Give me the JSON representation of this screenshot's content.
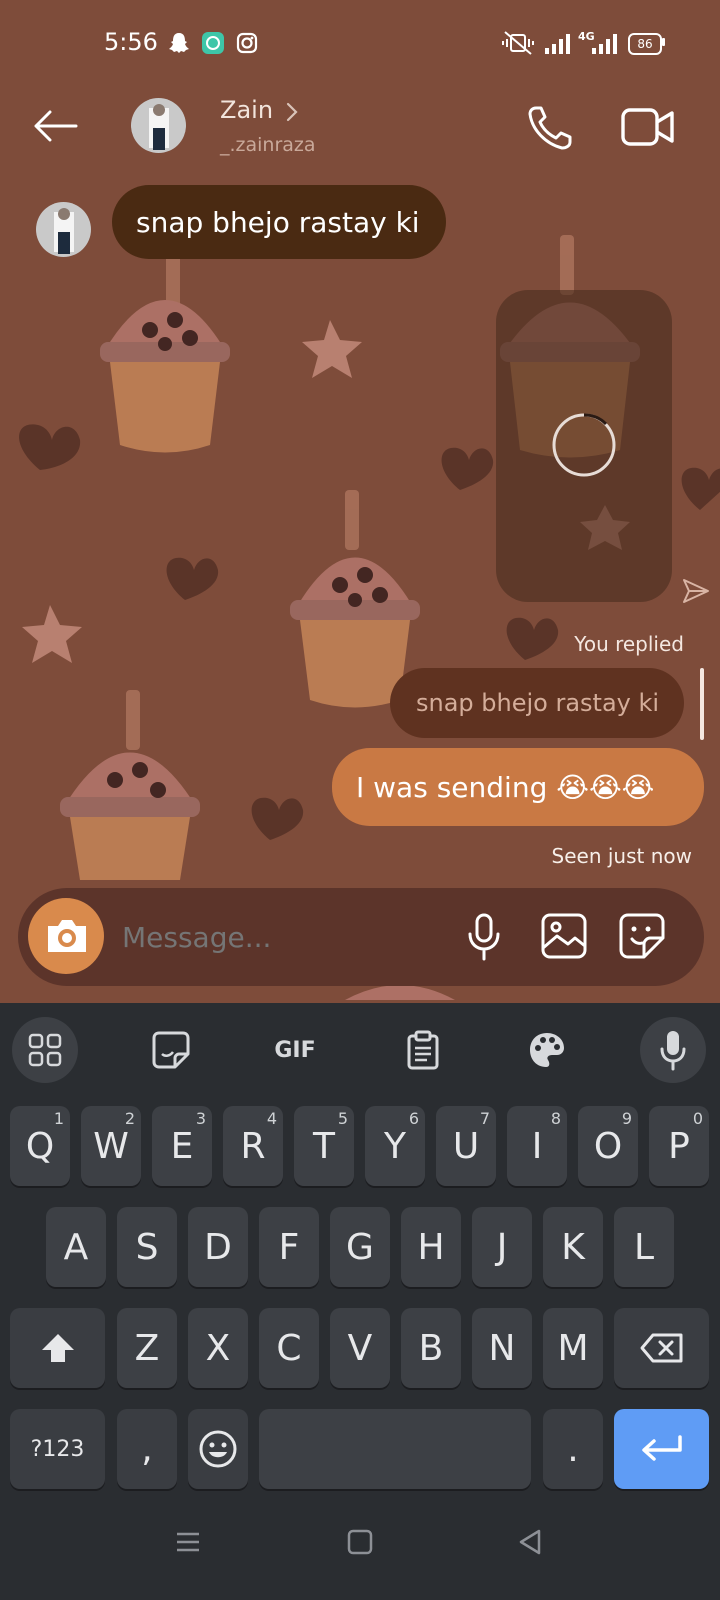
{
  "status_bar": {
    "time": "5:56",
    "icons": [
      "snapchat-icon",
      "chat-app-icon",
      "instagram-icon",
      "vibrate-icon",
      "signal-icon",
      "4g-signal-icon",
      "battery-icon"
    ],
    "network_label": "4G",
    "battery": "86"
  },
  "header": {
    "name": "Zain",
    "username": "_.zainraza",
    "actions": [
      "phone-icon",
      "video-call-icon"
    ]
  },
  "messages": {
    "incoming_1": "snap bhejo rastay ki",
    "replied_label": "You replied",
    "reply_quote": "snap bhejo rastay ki",
    "outgoing_1": "I was sending 😭😭😭",
    "seen": "Seen just now"
  },
  "composer": {
    "placeholder": "Message..."
  },
  "keyboard": {
    "toolbar": [
      "apps-icon",
      "sticker-icon",
      "GIF",
      "clipboard-icon",
      "palette-icon",
      "mic-icon"
    ],
    "row1": [
      {
        "k": "Q",
        "n": "1"
      },
      {
        "k": "W",
        "n": "2"
      },
      {
        "k": "E",
        "n": "3"
      },
      {
        "k": "R",
        "n": "4"
      },
      {
        "k": "T",
        "n": "5"
      },
      {
        "k": "Y",
        "n": "6"
      },
      {
        "k": "U",
        "n": "7"
      },
      {
        "k": "I",
        "n": "8"
      },
      {
        "k": "O",
        "n": "9"
      },
      {
        "k": "P",
        "n": "0"
      }
    ],
    "row2": [
      "A",
      "S",
      "D",
      "F",
      "G",
      "H",
      "J",
      "K",
      "L"
    ],
    "row3": [
      "Z",
      "X",
      "C",
      "V",
      "B",
      "N",
      "M"
    ],
    "symbols_label": "?123",
    "comma": ",",
    "period": "."
  },
  "colors": {
    "chat_bg": "#7e4c3a",
    "incoming_bubble": "#4a2a12",
    "outgoing_bubble": "#c97944",
    "composer": "#5c342a",
    "camera_button": "#d98a4c",
    "enter_key": "#5f9cf5"
  }
}
